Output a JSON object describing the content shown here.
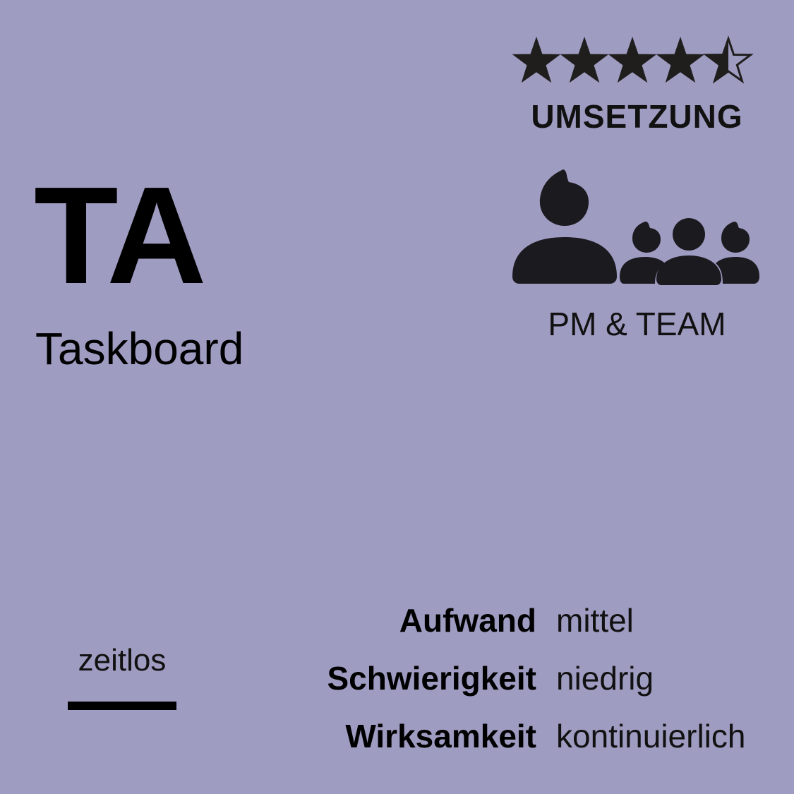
{
  "card": {
    "abbreviation": "TA",
    "name": "Taskboard",
    "colors": {
      "background": "#9f9cc2",
      "ink": "#111111"
    }
  },
  "rating": {
    "value": 4.5,
    "max": 5,
    "label": "UMSETZUNG"
  },
  "team": {
    "icon": "people-group-icon",
    "label": "PM & TEAM"
  },
  "timeframe": {
    "label": "zeitlos"
  },
  "metrics": [
    {
      "key": "Aufwand",
      "value": "mittel"
    },
    {
      "key": "Schwierigkeit",
      "value": "niedrig"
    },
    {
      "key": "Wirksamkeit",
      "value": "kontinuierlich"
    }
  ]
}
